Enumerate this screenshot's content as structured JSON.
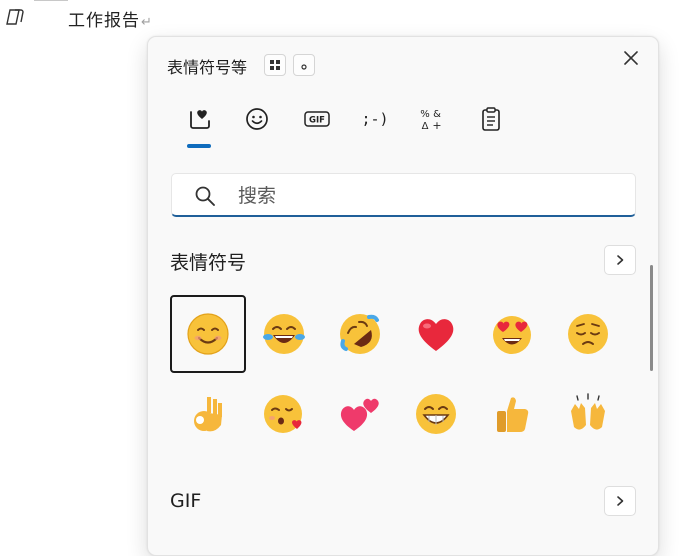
{
  "document": {
    "text": "工作报告",
    "paragraph_mark": "↵"
  },
  "panel": {
    "title": "表情符号等",
    "tabs": [
      {
        "name": "emoji-tab",
        "icon": "heart-box-icon",
        "active": true
      },
      {
        "name": "kaomoji-face-tab",
        "icon": "smiley-icon"
      },
      {
        "name": "gif-tab",
        "icon": "gif-icon",
        "label": "GIF"
      },
      {
        "name": "kaomoji-tab",
        "icon": "kaomoji-icon",
        "label": ";-)"
      },
      {
        "name": "symbols-tab",
        "icon": "symbols-icon"
      },
      {
        "name": "clipboard-tab",
        "icon": "clipboard-icon"
      }
    ],
    "search": {
      "placeholder": "搜索",
      "value": ""
    },
    "sections": {
      "emoji": {
        "title": "表情符号"
      },
      "gif": {
        "title": "GIF"
      }
    },
    "emojis": [
      "smiling-face",
      "face-with-tears-of-joy",
      "rolling-on-floor-laughing",
      "red-heart",
      "heart-eyes",
      "pensive-face",
      "ok-hand",
      "face-blowing-kiss",
      "two-hearts",
      "grinning-face",
      "thumbs-up",
      "raising-hands"
    ],
    "accent_color": "#0f6cbd"
  }
}
